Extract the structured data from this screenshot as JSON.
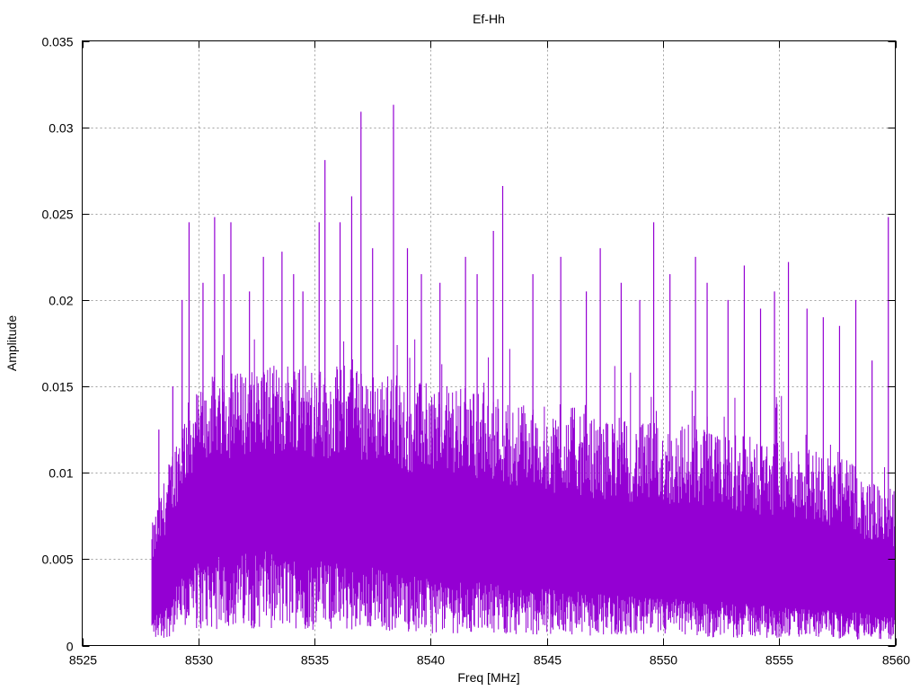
{
  "chart_data": {
    "type": "line",
    "title": "Ef-Hh",
    "xlabel": "Freq [MHz]",
    "ylabel": "Amplitude",
    "xlim": [
      8525,
      8560
    ],
    "ylim": [
      0,
      0.035
    ],
    "xticks": [
      "8525",
      "8530",
      "8535",
      "8540",
      "8545",
      "8550",
      "8555",
      "8560"
    ],
    "yticks": [
      "0",
      "0.005",
      "0.01",
      "0.015",
      "0.02",
      "0.025",
      "0.03",
      "0.035"
    ],
    "grid": true,
    "legend": "none",
    "series_color": "#9400d3",
    "data_range_x": [
      8528.0,
      8560.0
    ],
    "series": [
      {
        "x": [
          8528.0,
          8528.5,
          8529.0,
          8529.5,
          8530.0,
          8530.5,
          8531.0,
          8531.5,
          8532.0,
          8532.5,
          8533.0,
          8533.5,
          8534.0,
          8534.5,
          8535.0,
          8535.5,
          8536.0,
          8536.5,
          8537.0,
          8537.5,
          8538.0,
          8538.5,
          8539.0,
          8539.5,
          8540.0,
          8540.5,
          8541.0,
          8541.5,
          8542.0,
          8542.5,
          8543.0,
          8543.5,
          8544.0,
          8544.5,
          8545.0,
          8545.5,
          8546.0,
          8546.5,
          8547.0,
          8547.5,
          8548.0,
          8548.5,
          8549.0,
          8549.5,
          8550.0,
          8550.5,
          8551.0,
          8551.5,
          8552.0,
          8552.5,
          8553.0,
          8553.5,
          8554.0,
          8554.5,
          8555.0,
          8555.5,
          8556.0,
          8556.5,
          8557.0,
          8557.5,
          8558.0,
          8558.5,
          8559.0,
          8559.5,
          8560.0
        ],
        "upper": [
          0.007,
          0.0095,
          0.012,
          0.014,
          0.015,
          0.0155,
          0.016,
          0.0158,
          0.016,
          0.0162,
          0.0165,
          0.016,
          0.0168,
          0.0165,
          0.016,
          0.0158,
          0.0162,
          0.0165,
          0.016,
          0.0158,
          0.016,
          0.0155,
          0.015,
          0.0152,
          0.0155,
          0.015,
          0.0152,
          0.015,
          0.0148,
          0.015,
          0.0145,
          0.014,
          0.0142,
          0.014,
          0.0138,
          0.0135,
          0.014,
          0.0135,
          0.0132,
          0.013,
          0.0135,
          0.013,
          0.0128,
          0.013,
          0.0128,
          0.0125,
          0.013,
          0.0128,
          0.0125,
          0.012,
          0.0125,
          0.0122,
          0.012,
          0.0118,
          0.012,
          0.0115,
          0.0118,
          0.0115,
          0.0112,
          0.011,
          0.0108,
          0.01,
          0.0095,
          0.0092,
          0.009
        ],
        "lower": [
          0.0015,
          0.002,
          0.003,
          0.004,
          0.0045,
          0.0045,
          0.0048,
          0.0045,
          0.005,
          0.0048,
          0.005,
          0.0045,
          0.0048,
          0.0046,
          0.0045,
          0.0045,
          0.0044,
          0.0042,
          0.004,
          0.0042,
          0.004,
          0.0038,
          0.0038,
          0.0036,
          0.0035,
          0.0036,
          0.0035,
          0.0034,
          0.0033,
          0.0034,
          0.0032,
          0.0032,
          0.0031,
          0.003,
          0.003,
          0.003,
          0.0029,
          0.0028,
          0.0028,
          0.0028,
          0.0027,
          0.0026,
          0.0026,
          0.0025,
          0.0025,
          0.0025,
          0.0024,
          0.0024,
          0.0023,
          0.0023,
          0.0022,
          0.0022,
          0.0022,
          0.0021,
          0.002,
          0.002,
          0.002,
          0.0019,
          0.0019,
          0.0018,
          0.0018,
          0.0017,
          0.0016,
          0.0015,
          0.0015
        ]
      }
    ],
    "peaks": [
      {
        "x": 8528.3,
        "y": 0.0125
      },
      {
        "x": 8528.9,
        "y": 0.015
      },
      {
        "x": 8529.3,
        "y": 0.02
      },
      {
        "x": 8529.6,
        "y": 0.0245
      },
      {
        "x": 8530.2,
        "y": 0.021
      },
      {
        "x": 8530.7,
        "y": 0.0248
      },
      {
        "x": 8531.1,
        "y": 0.0215
      },
      {
        "x": 8531.4,
        "y": 0.0245
      },
      {
        "x": 8532.2,
        "y": 0.0205
      },
      {
        "x": 8532.8,
        "y": 0.0225
      },
      {
        "x": 8533.6,
        "y": 0.0228
      },
      {
        "x": 8534.1,
        "y": 0.0215
      },
      {
        "x": 8534.5,
        "y": 0.0205
      },
      {
        "x": 8535.2,
        "y": 0.0245
      },
      {
        "x": 8535.45,
        "y": 0.0281
      },
      {
        "x": 8536.1,
        "y": 0.0245
      },
      {
        "x": 8536.6,
        "y": 0.026
      },
      {
        "x": 8537.0,
        "y": 0.0309
      },
      {
        "x": 8537.5,
        "y": 0.023
      },
      {
        "x": 8538.4,
        "y": 0.0313
      },
      {
        "x": 8539.0,
        "y": 0.023
      },
      {
        "x": 8539.6,
        "y": 0.0215
      },
      {
        "x": 8540.4,
        "y": 0.021
      },
      {
        "x": 8541.5,
        "y": 0.0225
      },
      {
        "x": 8542.0,
        "y": 0.0215
      },
      {
        "x": 8542.7,
        "y": 0.024
      },
      {
        "x": 8543.1,
        "y": 0.0266
      },
      {
        "x": 8544.4,
        "y": 0.0215
      },
      {
        "x": 8545.6,
        "y": 0.0225
      },
      {
        "x": 8546.7,
        "y": 0.0205
      },
      {
        "x": 8547.3,
        "y": 0.023
      },
      {
        "x": 8548.2,
        "y": 0.021
      },
      {
        "x": 8549.0,
        "y": 0.02
      },
      {
        "x": 8549.6,
        "y": 0.0245
      },
      {
        "x": 8550.3,
        "y": 0.0215
      },
      {
        "x": 8551.4,
        "y": 0.0225
      },
      {
        "x": 8551.9,
        "y": 0.021
      },
      {
        "x": 8552.8,
        "y": 0.02
      },
      {
        "x": 8553.5,
        "y": 0.022
      },
      {
        "x": 8554.2,
        "y": 0.0195
      },
      {
        "x": 8554.8,
        "y": 0.0205
      },
      {
        "x": 8555.4,
        "y": 0.0222
      },
      {
        "x": 8556.2,
        "y": 0.0195
      },
      {
        "x": 8556.9,
        "y": 0.019
      },
      {
        "x": 8557.6,
        "y": 0.0185
      },
      {
        "x": 8558.3,
        "y": 0.02
      },
      {
        "x": 8559.0,
        "y": 0.0165
      },
      {
        "x": 8559.7,
        "y": 0.0248
      }
    ]
  }
}
